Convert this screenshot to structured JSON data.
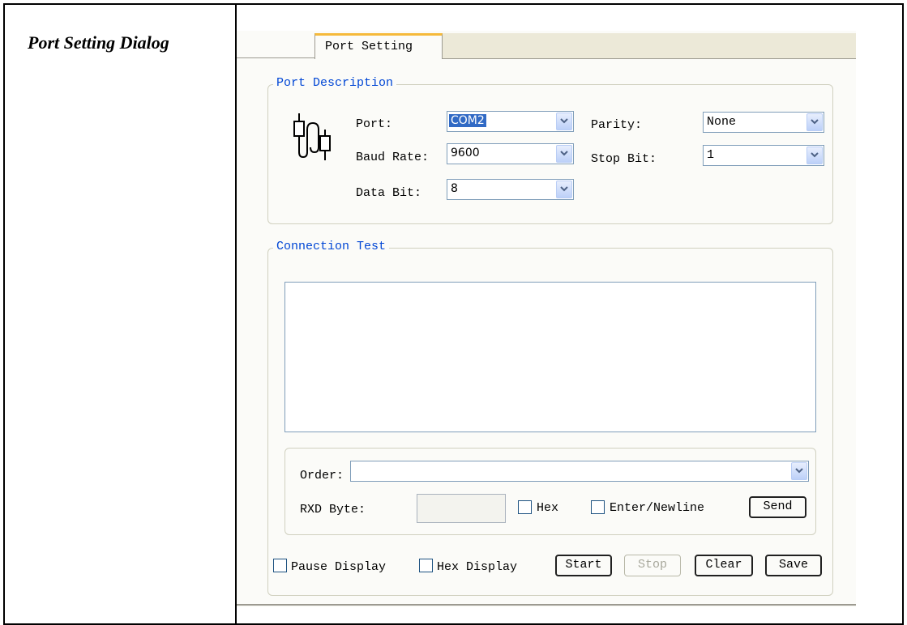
{
  "document": {
    "label": "Port Setting Dialog"
  },
  "dialog": {
    "tab_label": "Port Setting",
    "port_description": {
      "title": "Port Description",
      "port": {
        "label": "Port:",
        "value": "COM2"
      },
      "baud_rate": {
        "label": "Baud Rate:",
        "value": "9600"
      },
      "data_bit": {
        "label": "Data Bit:",
        "value": "8"
      },
      "parity": {
        "label": "Parity:",
        "value": "None"
      },
      "stop_bit": {
        "label": "Stop Bit:",
        "value": "1"
      },
      "icon": "serial-cable-icon"
    },
    "connection_test": {
      "title": "Connection Test",
      "log_text": "",
      "order_label": "Order:",
      "order_value": "",
      "rxd_label": "RXD Byte:",
      "rxd_value": "",
      "hex_label": "Hex",
      "enter_newline_label": "Enter/Newline",
      "send_label": "Send",
      "pause_display_label": "Pause Display",
      "hex_display_label": "Hex Display",
      "start_label": "Start",
      "stop_label": "Stop",
      "clear_label": "Clear",
      "save_label": "Save"
    }
  },
  "colors": {
    "group_title": "#0046d5",
    "tab_accent": "#f5b93a",
    "selection": "#316ac5",
    "field_border": "#7f9db9"
  }
}
